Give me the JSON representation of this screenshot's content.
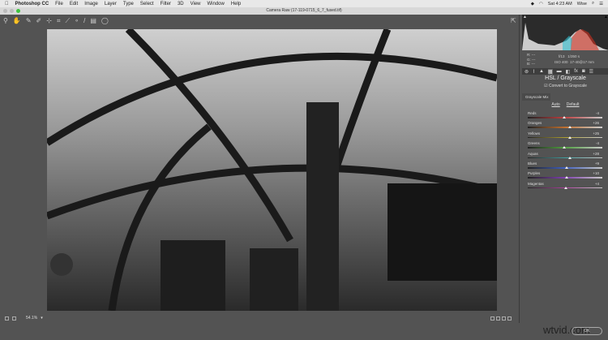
{
  "menubar": {
    "app": "Photoshop CC",
    "items": [
      "File",
      "Edit",
      "Image",
      "Layer",
      "Type",
      "Select",
      "Filter",
      "3D",
      "View",
      "Window",
      "Help"
    ],
    "clock": "Sat 4:23 AM",
    "user": "Wise"
  },
  "window": {
    "title": "Camera Raw (17-119-0715_6_7_fused.tif)"
  },
  "meta": {
    "f": "f/13",
    "shutter": "1/350 s",
    "iso": "ISO 400",
    "lens": "17-40@17 mm",
    "rgb": [
      "---",
      "---",
      "---"
    ]
  },
  "panel": {
    "title": "HSL / Grayscale",
    "convert_label": "Convert to Grayscale",
    "convert_checked": true,
    "tab": "Grayscale Mix",
    "auto": "Auto",
    "default": "Default",
    "sliders": [
      {
        "label": "Reds",
        "value": "-4",
        "n": -4,
        "color": "#c04040"
      },
      {
        "label": "Oranges",
        "value": "+26",
        "n": 26,
        "color": "#c07030"
      },
      {
        "label": "Yellows",
        "value": "+25",
        "n": 25,
        "color": "#b0a030"
      },
      {
        "label": "Greens",
        "value": "-4",
        "n": -4,
        "color": "#50a040"
      },
      {
        "label": "Aquas",
        "value": "+28",
        "n": 28,
        "color": "#40a0a0"
      },
      {
        "label": "Blues",
        "value": "+9",
        "n": 9,
        "color": "#4060c0"
      },
      {
        "label": "Purples",
        "value": "+10",
        "n": 10,
        "color": "#8040b0"
      },
      {
        "label": "Magentas",
        "value": "+4",
        "n": 4,
        "color": "#b040a0"
      }
    ]
  },
  "bottom": {
    "zoom": "54.1%"
  },
  "ok_label": "OK",
  "watermark": "wtvid.com"
}
